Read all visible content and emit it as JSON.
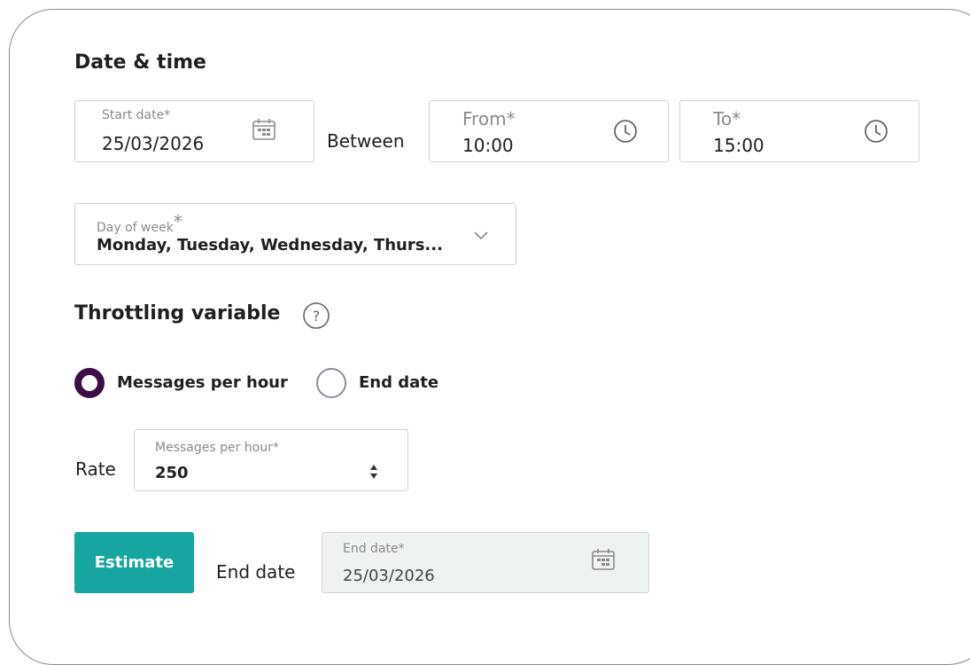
{
  "date_time": {
    "heading": "Date & time",
    "start_date": {
      "label": "Start date*",
      "value": "25/03/2026"
    },
    "between_label": "Between",
    "from": {
      "label": "From*",
      "value": "10:00"
    },
    "to": {
      "label": "To*",
      "value": "15:00"
    },
    "day_of_week": {
      "label": "Day of week",
      "required_mark": "*",
      "value": "Monday, Tuesday, Wednesday, Thurs..."
    }
  },
  "throttling": {
    "heading": "Throttling variable",
    "help_icon_text": "?",
    "options": [
      {
        "label": "Messages per hour",
        "selected": true
      },
      {
        "label": "End date",
        "selected": false
      }
    ],
    "rate_label": "Rate",
    "rate_field": {
      "label": "Messages per hour*",
      "value": "250"
    }
  },
  "estimate": {
    "button_label": "Estimate",
    "end_date_label": "End date",
    "end_date_field": {
      "label": "End date*",
      "value": "25/03/2026"
    }
  },
  "colors": {
    "accent": "#16a5a0",
    "radio_selected": "#3d0d45",
    "disabled_bg": "#eff2f2"
  }
}
